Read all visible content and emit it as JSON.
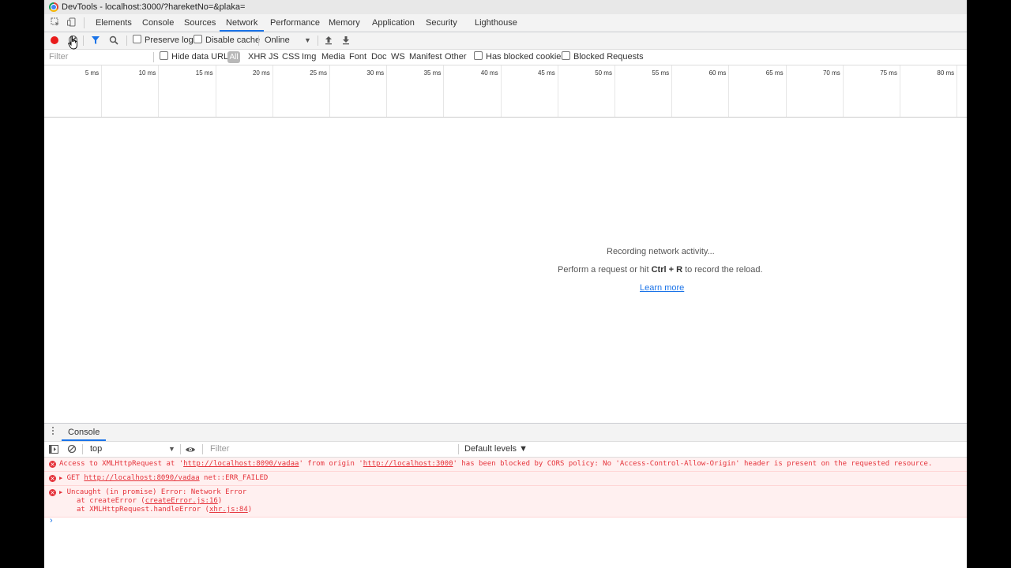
{
  "window": {
    "title": "DevTools - localhost:3000/?hareketNo=&plaka="
  },
  "tabs": [
    "Elements",
    "Console",
    "Sources",
    "Network",
    "Performance",
    "Memory",
    "Application",
    "Security",
    "Lighthouse"
  ],
  "active_tab": "Network",
  "toolbar": {
    "preserve_log": "Preserve log",
    "disable_cache": "Disable cache",
    "throttling": "Online"
  },
  "filterbar": {
    "filter_placeholder": "Filter",
    "hide_data_urls": "Hide data URLs",
    "types": [
      "All",
      "XHR",
      "JS",
      "CSS",
      "Img",
      "Media",
      "Font",
      "Doc",
      "WS",
      "Manifest",
      "Other"
    ],
    "has_blocked_cookies": "Has blocked cookies",
    "blocked_requests": "Blocked Requests"
  },
  "timeline": {
    "ticks": [
      "5 ms",
      "10 ms",
      "15 ms",
      "20 ms",
      "25 ms",
      "30 ms",
      "35 ms",
      "40 ms",
      "45 ms",
      "50 ms",
      "55 ms",
      "60 ms",
      "65 ms",
      "70 ms",
      "75 ms",
      "80 ms"
    ]
  },
  "empty_state": {
    "line1": "Recording network activity...",
    "line2_pre": "Perform a request or hit ",
    "line2_key": "Ctrl + R",
    "line2_post": " to record the reload.",
    "learn_more": "Learn more"
  },
  "drawer": {
    "tab": "Console"
  },
  "console_toolbar": {
    "context": "top",
    "filter_placeholder": "Filter",
    "levels": "Default levels ▼"
  },
  "console": {
    "msg1": {
      "a": "Access to XMLHttpRequest at '",
      "url1": "http://localhost:8090/vadaa",
      "b": "' from origin '",
      "url2": "http://localhost:3000",
      "c": "' has been blocked by CORS policy: No 'Access-Control-Allow-Origin' header is present on the requested resource."
    },
    "msg2": {
      "method": "GET ",
      "url": "http://localhost:8090/vadaa",
      "status": " net::ERR_FAILED"
    },
    "msg3": {
      "head": "Uncaught (in promise) Error: Network Error",
      "s1_pre": "at createError (",
      "s1_link": "createError.js:16",
      "s1_post": ")",
      "s2_pre": "at XMLHttpRequest.handleError (",
      "s2_link": "xhr.js:84",
      "s2_post": ")"
    }
  },
  "colors": {
    "accent": "#1a73e8",
    "record": "#e91b1b",
    "error_text": "#e5323a",
    "error_bg": "#fff0f0"
  }
}
